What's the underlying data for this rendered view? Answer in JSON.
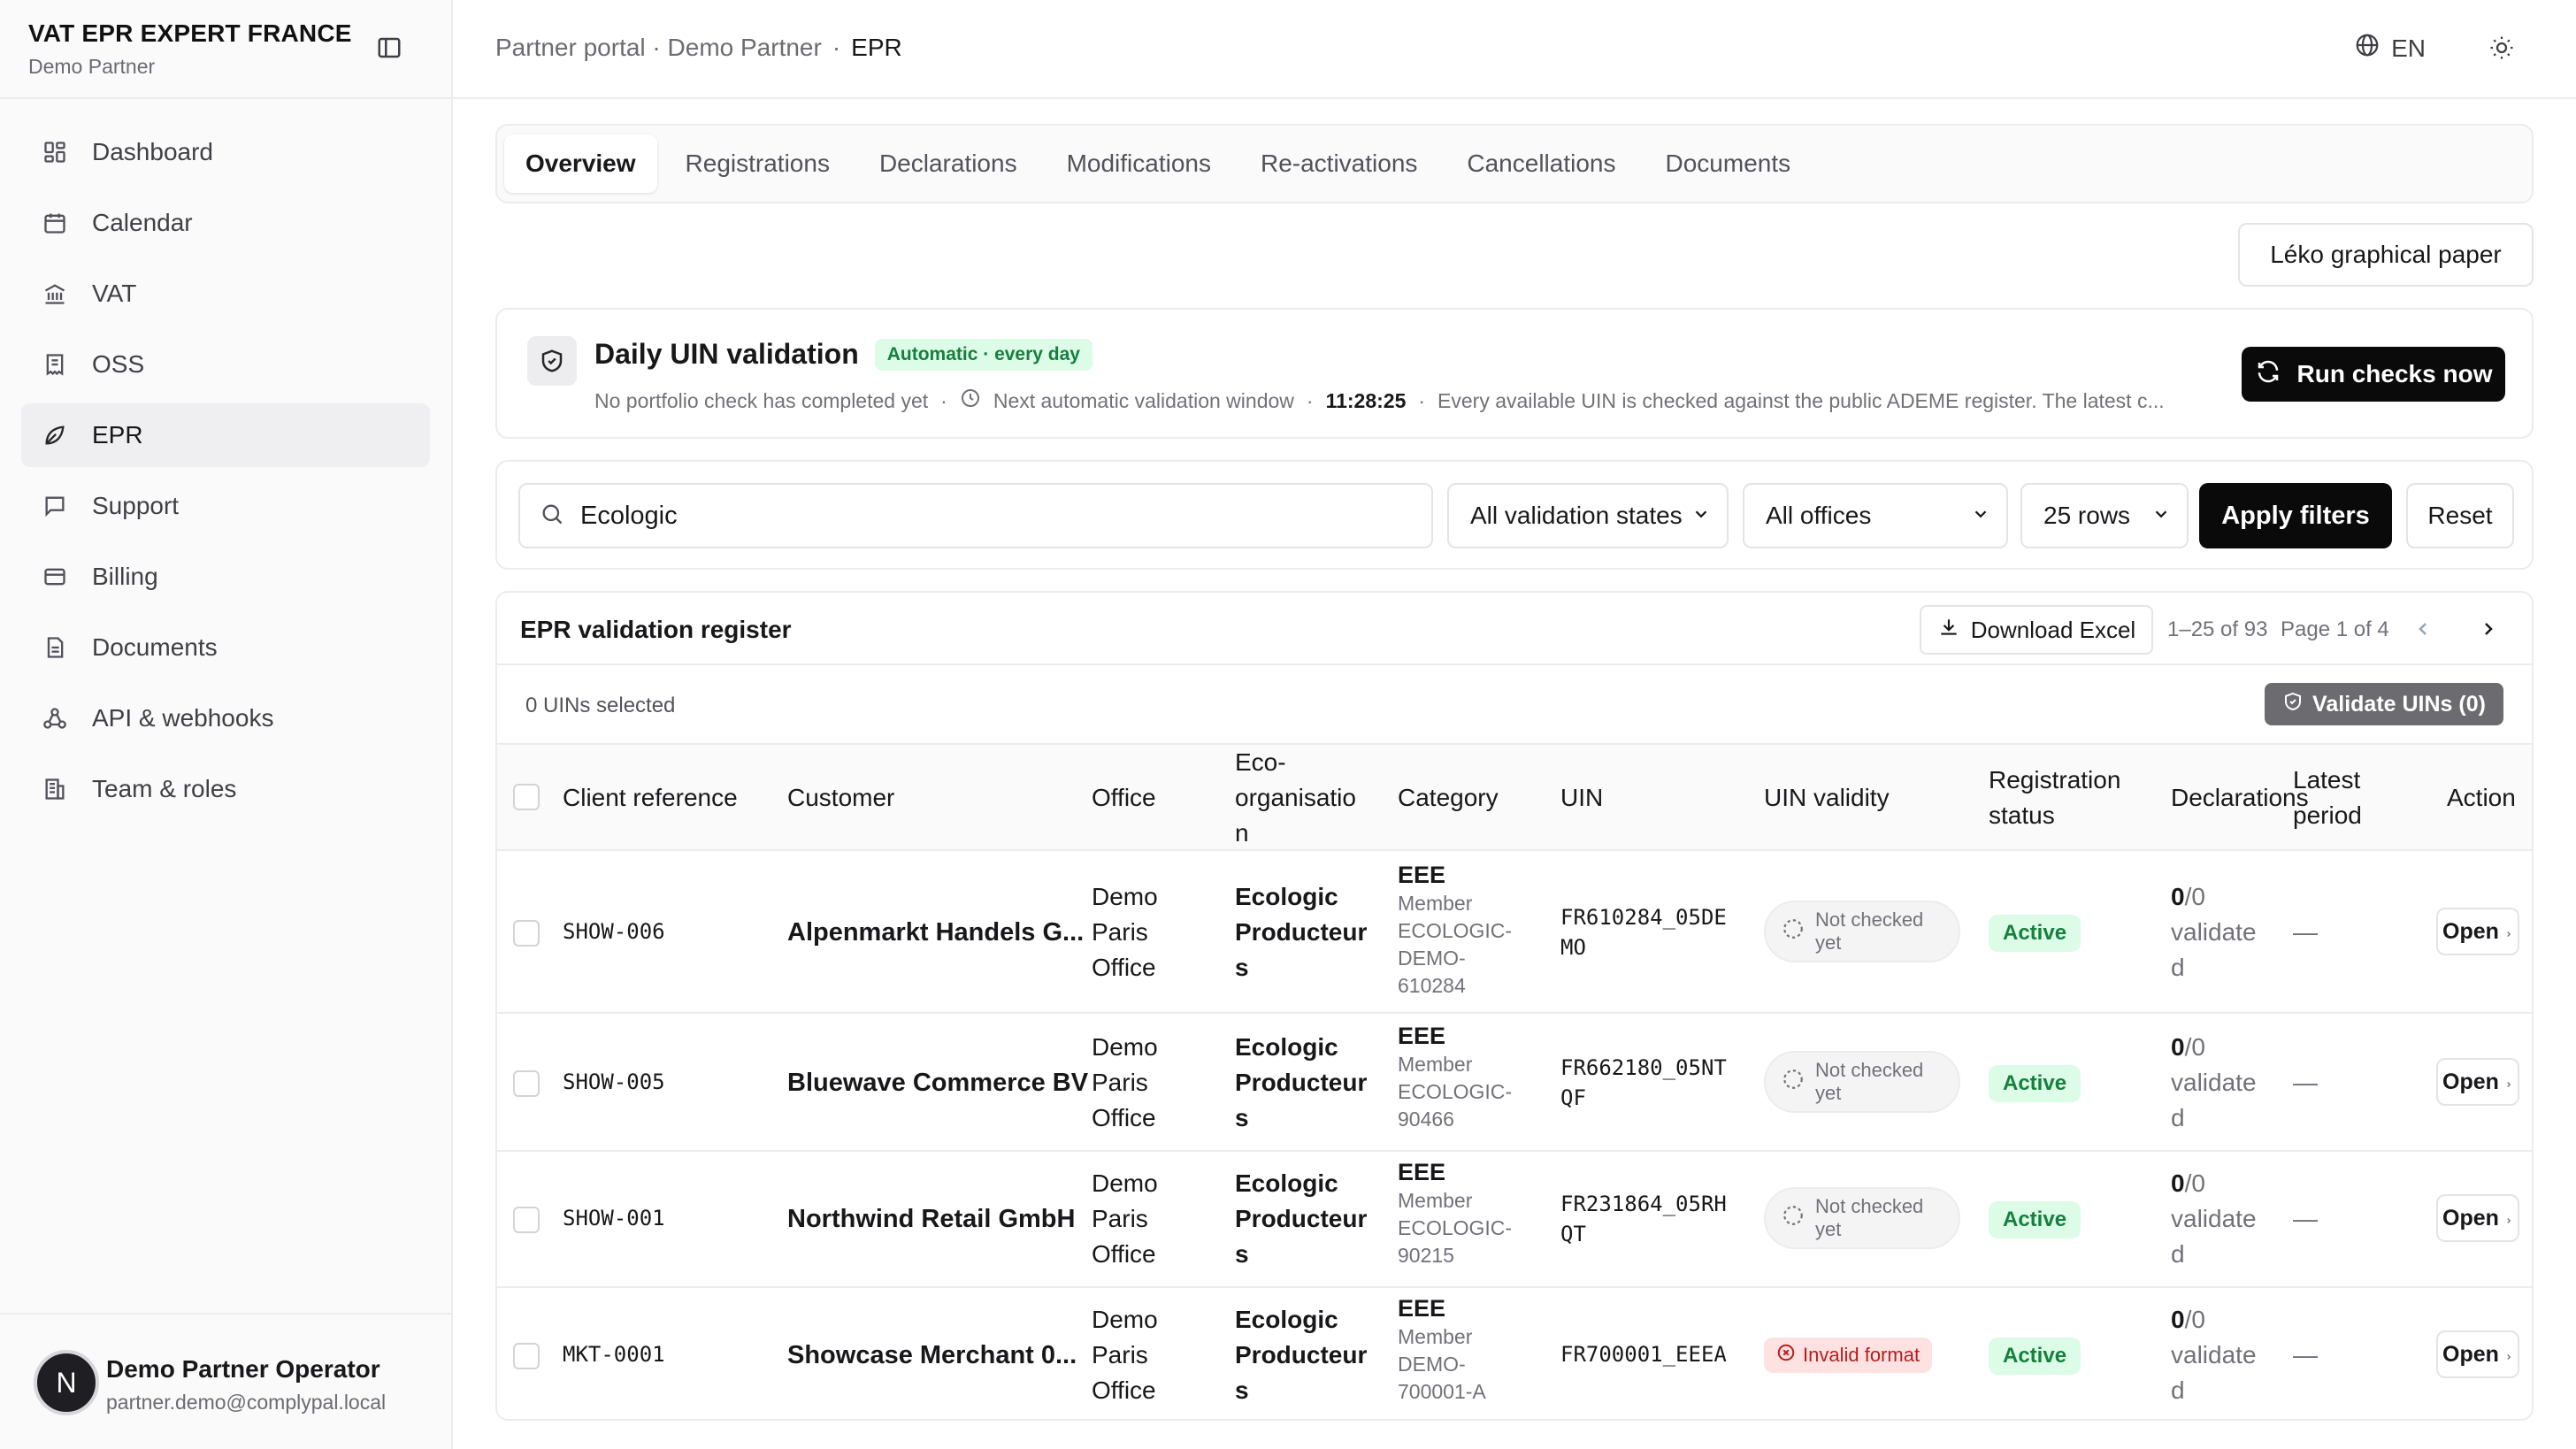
{
  "sidebar": {
    "brand_title": "VAT EPR EXPERT FRANCE",
    "brand_subtitle": "Demo Partner",
    "items": [
      {
        "label": "Dashboard",
        "icon": "dashboard-icon"
      },
      {
        "label": "Calendar",
        "icon": "calendar-icon"
      },
      {
        "label": "VAT",
        "icon": "bank-icon"
      },
      {
        "label": "OSS",
        "icon": "receipt-icon"
      },
      {
        "label": "EPR",
        "icon": "leaf-icon",
        "active": true
      },
      {
        "label": "Support",
        "icon": "message-icon"
      },
      {
        "label": "Billing",
        "icon": "credit-card-icon"
      },
      {
        "label": "Documents",
        "icon": "document-icon"
      },
      {
        "label": "API & webhooks",
        "icon": "webhook-icon"
      },
      {
        "label": "Team & roles",
        "icon": "building-icon"
      }
    ],
    "user": {
      "initial": "N",
      "name": "Demo Partner Operator",
      "email": "partner.demo@complypal.local"
    }
  },
  "header": {
    "breadcrumb_parent": "Partner portal · Demo Partner",
    "breadcrumb_sep": "·",
    "breadcrumb_current": "EPR",
    "language": "EN"
  },
  "tabs": [
    "Overview",
    "Registrations",
    "Declarations",
    "Modifications",
    "Re-activations",
    "Cancellations",
    "Documents"
  ],
  "paper_button": "Léko graphical paper",
  "validation": {
    "title": "Daily UIN validation",
    "badge": "Automatic · every day",
    "status": "No portfolio check has completed yet",
    "sep": "·",
    "next_window_label": "Next automatic validation window",
    "sep2": "·",
    "countdown": "11:28:25",
    "sep3": "·",
    "info": "Every available UIN is checked against the public ADEME register. The latest c...",
    "run_button": "Run checks now"
  },
  "filters": {
    "search_value": "Ecologic",
    "validation_state": "All validation states",
    "office": "All offices",
    "rows": "25 rows",
    "apply": "Apply filters",
    "reset": "Reset"
  },
  "register": {
    "title": "EPR validation register",
    "download": "Download Excel",
    "range": "1–25 of 93",
    "page": "Page 1 of 4",
    "selected": "0 UINs selected",
    "validate_button": "Validate UINs (0)",
    "columns": {
      "client_ref": "Client reference",
      "customer": "Customer",
      "office": "Office",
      "eco": "Eco-organisatio n",
      "category": "Category",
      "uin": "UIN",
      "uin_validity": "UIN validity",
      "registration_status": "Registration status",
      "declarations": "Declarations",
      "latest_period": "Latest period",
      "action": "Action"
    },
    "rows": [
      {
        "ref": "SHOW-006",
        "customer": "Alpenmarkt Handels G...",
        "office": "Demo Paris Office",
        "eco": "Ecologic Producteur s",
        "category": "EEE",
        "member": "Member ECOLOGIC-DEMO-610284",
        "uin": "FR610284_05DE MO",
        "validity": "Not checked yet",
        "status": "Active",
        "decl_count": "0",
        "decl_rest": "/0 validate d",
        "period": "—",
        "action": "Open"
      },
      {
        "ref": "SHOW-005",
        "customer": "Bluewave Commerce BV",
        "office": "Demo Paris Office",
        "eco": "Ecologic Producteur s",
        "category": "EEE",
        "member": "Member ECOLOGIC-90466",
        "uin": "FR662180_05NT QF",
        "validity": "Not checked yet",
        "status": "Active",
        "decl_count": "0",
        "decl_rest": "/0 validate d",
        "period": "—",
        "action": "Open"
      },
      {
        "ref": "SHOW-001",
        "customer": "Northwind Retail GmbH",
        "office": "Demo Paris Office",
        "eco": "Ecologic Producteur s",
        "category": "EEE",
        "member": "Member ECOLOGIC-90215",
        "uin": "FR231864_05RH QT",
        "validity": "Not checked yet",
        "status": "Active",
        "decl_count": "0",
        "decl_rest": "/0 validate d",
        "period": "—",
        "action": "Open"
      },
      {
        "ref": "MKT-0001",
        "customer": "Showcase Merchant 0...",
        "office": "Demo Paris Office",
        "eco": "Ecologic Producteur s",
        "category": "EEE",
        "member": "Member DEMO-700001-A",
        "uin": "FR700001_EEEA",
        "validity": "Invalid format",
        "status": "Active",
        "decl_count": "0",
        "decl_rest": "/0 validate d",
        "period": "—",
        "action": "Open"
      }
    ]
  }
}
